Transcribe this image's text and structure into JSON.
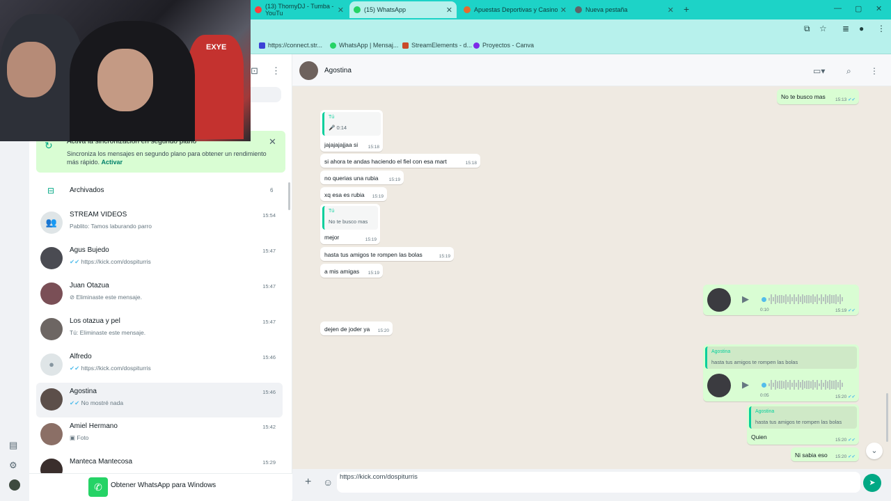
{
  "browser": {
    "tabs": [
      {
        "label": "(13) ThornyDJ - Tumba - YouTu",
        "color": "#ff3d3d"
      },
      {
        "label": "(15) WhatsApp",
        "color": "#25d366"
      },
      {
        "label": "Apuestas Deportivas y Casino C",
        "color": "#e56b2e"
      },
      {
        "label": "Nueva pestaña",
        "color": "#5f6368"
      }
    ],
    "new_tab": "+",
    "bookmarks": [
      {
        "label": "https://connect.str...",
        "color": "#3b42d6"
      },
      {
        "label": "WhatsApp | Mensaj...",
        "color": "#25d366"
      },
      {
        "label": "StreamElements - d...",
        "color": "#c94a2a"
      },
      {
        "label": "Proyectos - Canva",
        "color": "#7d2ae8"
      }
    ],
    "window_controls": {
      "minimize": "—",
      "maximize": "▢",
      "close": "✕"
    }
  },
  "banner": {
    "title": "Activa la sincronización en segundo plano",
    "text": "Sincroniza los mensajes en segundo plano para obtener un rendimiento más rápido.",
    "link": "Activar"
  },
  "archived": {
    "label": "Archivados",
    "count": "6"
  },
  "chats": [
    {
      "name": "STREAM VIDEOS",
      "preview": "Pablito: Tamos laburando parro",
      "time": "15:54",
      "tick": false
    },
    {
      "name": "Agus Bujedo",
      "preview": "https://kick.com/dospiturris",
      "time": "15:47",
      "tick": true
    },
    {
      "name": "Juan Otazua",
      "preview": "Eliminaste este mensaje.",
      "time": "15:47",
      "tick": false,
      "deleted": true
    },
    {
      "name": "Los otazua y pel",
      "preview": "Tú: Eliminaste este mensaje.",
      "time": "15:47",
      "tick": false,
      "deleted": true
    },
    {
      "name": "Alfredo",
      "preview": "https://kick.com/dospiturris",
      "time": "15:46",
      "tick": true
    },
    {
      "name": "Agostina",
      "preview": "No mostré nada",
      "time": "15:46",
      "tick": true
    },
    {
      "name": "Amiel Hermano",
      "preview": "Foto",
      "time": "15:42",
      "tick": false
    },
    {
      "name": "Manteca Mantecosa",
      "preview": "",
      "time": "15:29",
      "tick": false
    }
  ],
  "get_whatsapp": "Obtener WhatsApp para Windows",
  "conversation": {
    "contact": "Agostina",
    "messages": {
      "out_top": {
        "text": "No te busco mas",
        "time": "15:13"
      },
      "in_voice_quote": {
        "name": "Tú",
        "dur": "0:14"
      },
      "in1": {
        "text": "jajajajajjaa si",
        "time": "15:18"
      },
      "in2": {
        "text": "si ahora te andas haciendo el fiel con esa mart",
        "time": "15:18"
      },
      "in3": {
        "text": "no querias una rubia",
        "time": "15:19"
      },
      "in4": {
        "text": "xq esa es rubia",
        "time": "15:19"
      },
      "in5_quote": {
        "name": "Tú",
        "text": "No te busco mas"
      },
      "in5": {
        "text": "mejor",
        "time": "15:19"
      },
      "in6": {
        "text": "hasta tus amigos te rompen las bolas",
        "time": "15:19"
      },
      "in7": {
        "text": "a mis amigas",
        "time": "15:19"
      },
      "out_voice1": {
        "dur": "0:10",
        "time": "15:19"
      },
      "in8": {
        "text": "dejen de joder ya",
        "time": "15:20"
      },
      "out_voice2_quote": {
        "name": "Agostina",
        "text": "hasta tus amigos te rompen las bolas"
      },
      "out_voice2": {
        "dur": "0:05",
        "time": "15:20"
      },
      "out_q_quote": {
        "name": "Agostina",
        "text": "hasta tus amigos te rompen las bolas"
      },
      "out_q": {
        "text": "Quien",
        "time": "15:20"
      },
      "out_last": {
        "text": "Ni sabia eso",
        "time": "15:20"
      }
    }
  },
  "composer": {
    "value": "https://kick.com/dospiturris"
  },
  "colors": {
    "accent": "#00a884",
    "tick": "#53bdeb",
    "outgoing": "#d9fdd3",
    "chat_bg": "#efeae2"
  },
  "icons": [
    "search-icon",
    "video-call-icon",
    "menu-icon",
    "plus-icon",
    "emoji-icon",
    "send-icon",
    "play-icon",
    "mic-icon",
    "archive-icon",
    "settings-icon"
  ]
}
